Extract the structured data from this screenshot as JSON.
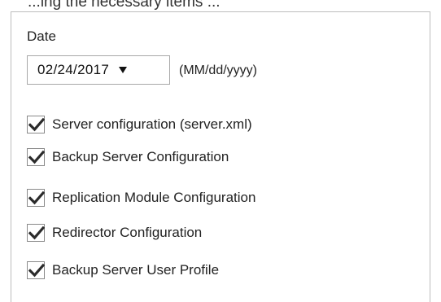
{
  "header_fragment": "...ing the necessary items ...",
  "date": {
    "label": "Date",
    "value": "02/24/2017",
    "format_hint": "(MM/dd/yyyy)"
  },
  "options": [
    {
      "label": "Server configuration (server.xml)",
      "checked": true
    },
    {
      "label": "Backup Server Configuration",
      "checked": true
    },
    {
      "label": "Replication Module Configuration",
      "checked": true
    },
    {
      "label": "Redirector Configuration",
      "checked": true
    },
    {
      "label": "Backup Server User Profile",
      "checked": true
    }
  ],
  "colors": {
    "checkmark": "#2b2b2b",
    "border": "#bdbdbd"
  },
  "icons": {
    "dropdown": "caret-down-icon",
    "check": "checkmark-icon"
  }
}
